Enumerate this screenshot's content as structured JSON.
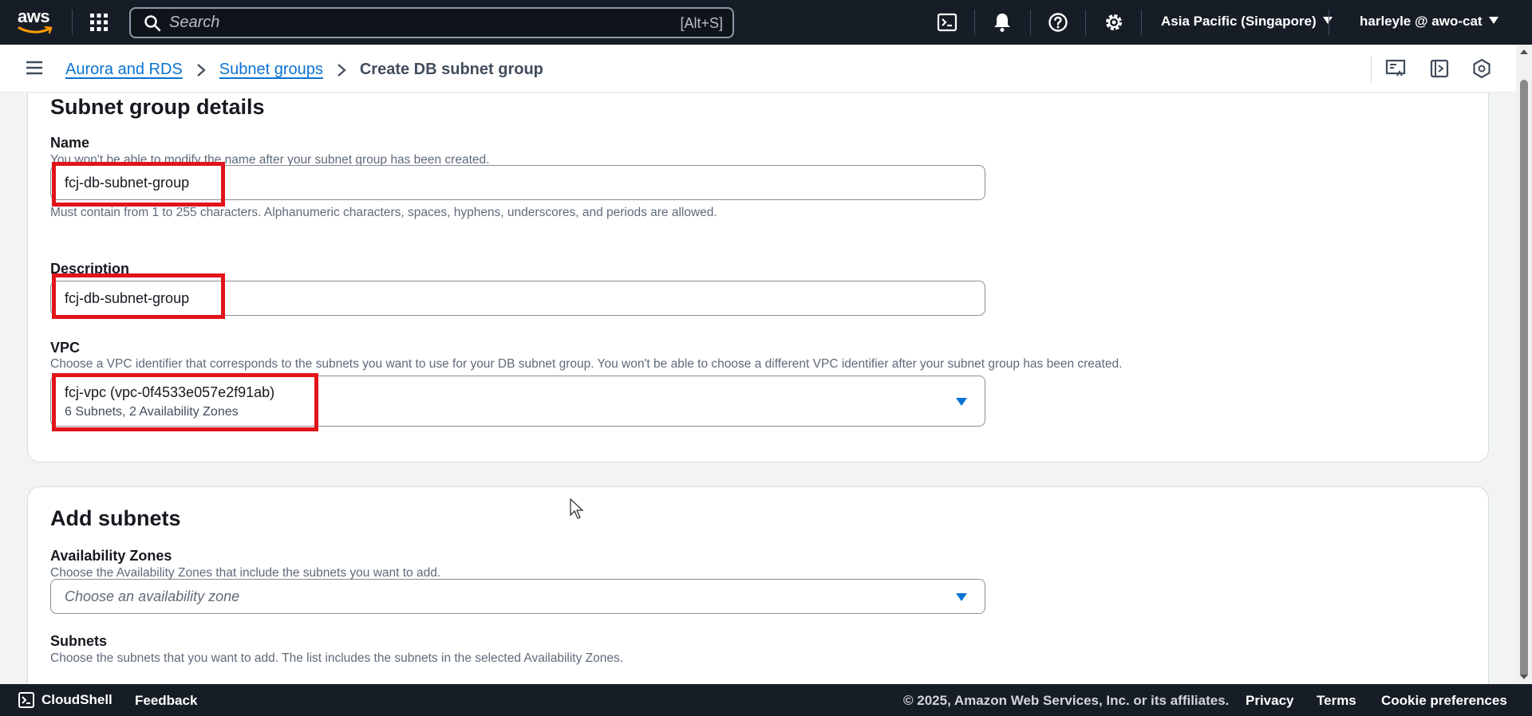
{
  "topnav": {
    "logo_text": "aws",
    "search_placeholder": "Search",
    "search_shortcut": "[Alt+S]",
    "region": "Asia Pacific (Singapore)",
    "user": "harleyle @ awo-cat"
  },
  "breadcrumb": {
    "items": [
      "Aurora and RDS",
      "Subnet groups"
    ],
    "current": "Create DB subnet group"
  },
  "subnet_group_details": {
    "title": "Subnet group details",
    "name": {
      "label": "Name",
      "description": "You won't be able to modify the name after your subnet group has been created.",
      "value": "fcj-db-subnet-group",
      "constraint": "Must contain from 1 to 255 characters. Alphanumeric characters, spaces, hyphens, underscores, and periods are allowed."
    },
    "description": {
      "label": "Description",
      "value": "fcj-db-subnet-group"
    },
    "vpc": {
      "label": "VPC",
      "description": "Choose a VPC identifier that corresponds to the subnets you want to use for your DB subnet group. You won't be able to choose a different VPC identifier after your subnet group has been created.",
      "value": "fcj-vpc (vpc-0f4533e057e2f91ab)",
      "subtext": "6 Subnets, 2 Availability Zones"
    }
  },
  "add_subnets": {
    "title": "Add subnets",
    "availability_zones": {
      "label": "Availability Zones",
      "description": "Choose the Availability Zones that include the subnets you want to add.",
      "placeholder": "Choose an availability zone"
    },
    "subnets": {
      "label": "Subnets",
      "description": "Choose the subnets that you want to add. The list includes the subnets in the selected Availability Zones."
    }
  },
  "footer": {
    "cloudshell": "CloudShell",
    "feedback": "Feedback",
    "copyright": "© 2025, Amazon Web Services, Inc. or its affiliates.",
    "privacy": "Privacy",
    "terms": "Terms",
    "cookie_preferences": "Cookie preferences"
  },
  "colors": {
    "nav_bg": "#161d26",
    "link": "#0972d3",
    "highlight": "#e1141b"
  }
}
